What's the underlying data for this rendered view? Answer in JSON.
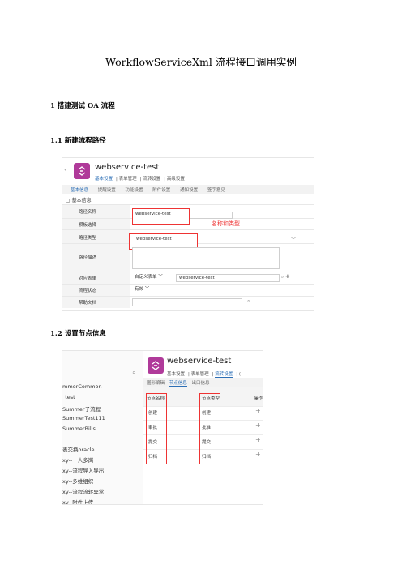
{
  "doc": {
    "title": "WorkflowServiceXml 流程接口调用实例",
    "h1": "1 搭建测试 OA 流程",
    "h2a": "1.1 新建流程路径",
    "h2b": "1.2 设置节点信息"
  },
  "shot1": {
    "back": "‹",
    "app_name": "webservice-test",
    "tabs": [
      "基本设置",
      "表单管理",
      "流转设置",
      "高级设置"
    ],
    "subtabs": [
      "基本信息",
      "提醒设置",
      "功能设置",
      "附件设置",
      "通知设置",
      "签字意见"
    ],
    "section": "基本信息",
    "rows": [
      {
        "label": "路径名称",
        "value": "webservice-test"
      },
      {
        "label": "模板选择",
        "value": ""
      },
      {
        "label": "路径类型",
        "value": "webservice-test"
      },
      {
        "label": "路径描述",
        "value": ""
      },
      {
        "label": "对应表单",
        "value": "自定义表单",
        "value2": "webservice-test"
      },
      {
        "label": "流程状态",
        "value": "有效"
      },
      {
        "label": "帮助文档",
        "value": ""
      }
    ],
    "annotation": "名称和类型",
    "brand_color": "#b03a9a"
  },
  "shot2": {
    "side_items": [
      "",
      "mmerCommon",
      "_test",
      "Summer子流程",
      "SummerTest111",
      "SummerBills",
      "",
      "表交换oracle",
      "xy--一人多岗",
      "xy--流程导入导出",
      "xy--多维组织",
      "xy--流程流转异常",
      "xy--附件上传"
    ],
    "search_icon": "search-icon",
    "app_name": "webservice-test",
    "tabs": [
      "基本设置",
      "表单管理",
      "流转设置",
      "("
    ],
    "subtabs": [
      "图形编辑",
      "节点信息",
      "出口信息"
    ],
    "headers": [
      "节点名称",
      "节点类型",
      "操作"
    ],
    "rows": [
      {
        "name": "创建",
        "type": "创建"
      },
      {
        "name": "审批",
        "type": "批准"
      },
      {
        "name": "提交",
        "type": "提交"
      },
      {
        "name": "归档",
        "type": "归档"
      }
    ]
  }
}
